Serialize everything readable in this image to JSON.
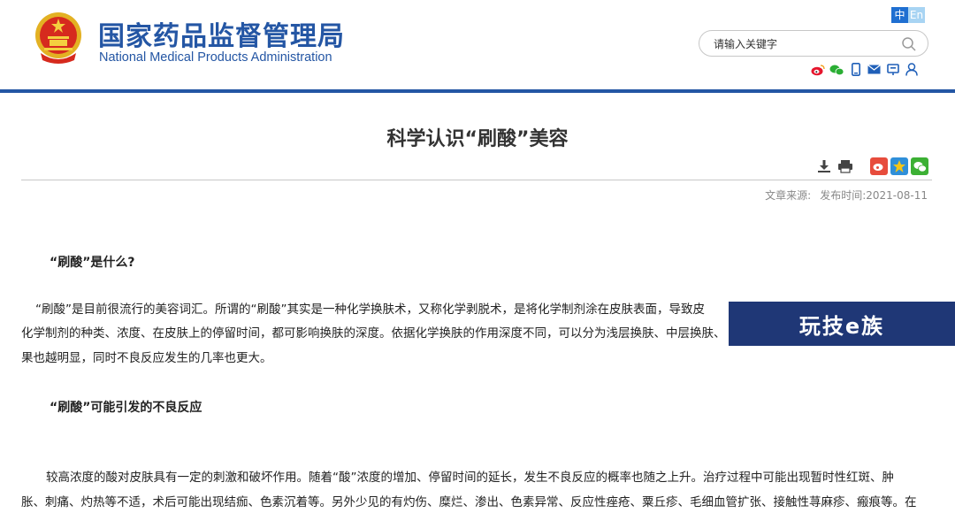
{
  "header": {
    "org_name_cn": "国家药品监督管理局",
    "org_name_en": "National Medical Products Administration",
    "lang_zh": "中",
    "lang_en": "En",
    "search_placeholder": "请输入关键字",
    "tool_icons": [
      "weibo-icon",
      "wechat-icon",
      "mobile-icon",
      "mail-icon",
      "message-icon",
      "user-icon"
    ]
  },
  "article": {
    "title": "科学认识“刷酸”美容",
    "source_label": "文章来源:",
    "published_label": "发布时间:",
    "published_date": "2021-08-11",
    "tools": [
      "download-icon",
      "print-icon"
    ],
    "share": [
      "weibo-share-icon",
      "qzone-share-icon",
      "wechat-share-icon"
    ],
    "sections": [
      {
        "heading": "“刷酸”是什么?",
        "body_line1": "“刷酸”是目前很流行的美容词汇。所谓的“刷酸”其实是一种化学换肤术，又称化学剥脱术，是将化学制剂涂在皮肤表面，导致皮",
        "body_line2": "化学制剂的种类、浓度、在皮肤上的停留时间，都可影响换肤的深度。依据化学换肤的作用深度不同，可以分为浅层换肤、中层换肤、",
        "body_line3": "果也越明显，同时不良反应发生的几率也更大。"
      },
      {
        "heading": "“刷酸”可能引发的不良反应",
        "body_line1": "较高浓度的酸对皮肤具有一定的刺激和破坏作用。随着“酸”浓度的增加、停留时间的延长，发生不良反应的概率也随之上升。治疗过程中可能出现暂时性红斑、肿",
        "body_line2": "胀、刺痛、灼热等不适，术后可能出现结痂、色素沉着等。另外少见的有灼伤、糜烂、渗出、色素异常、反应性痤疮、粟丘疹、毛细血管扩张、接触性荨麻疹、瘢痕等。在"
      }
    ]
  },
  "watermark": {
    "text": "玩技e族"
  },
  "colors": {
    "brand_blue": "#2456a4",
    "lang_active": "#1f6fd1",
    "watermark_bg": "#1f3776"
  }
}
